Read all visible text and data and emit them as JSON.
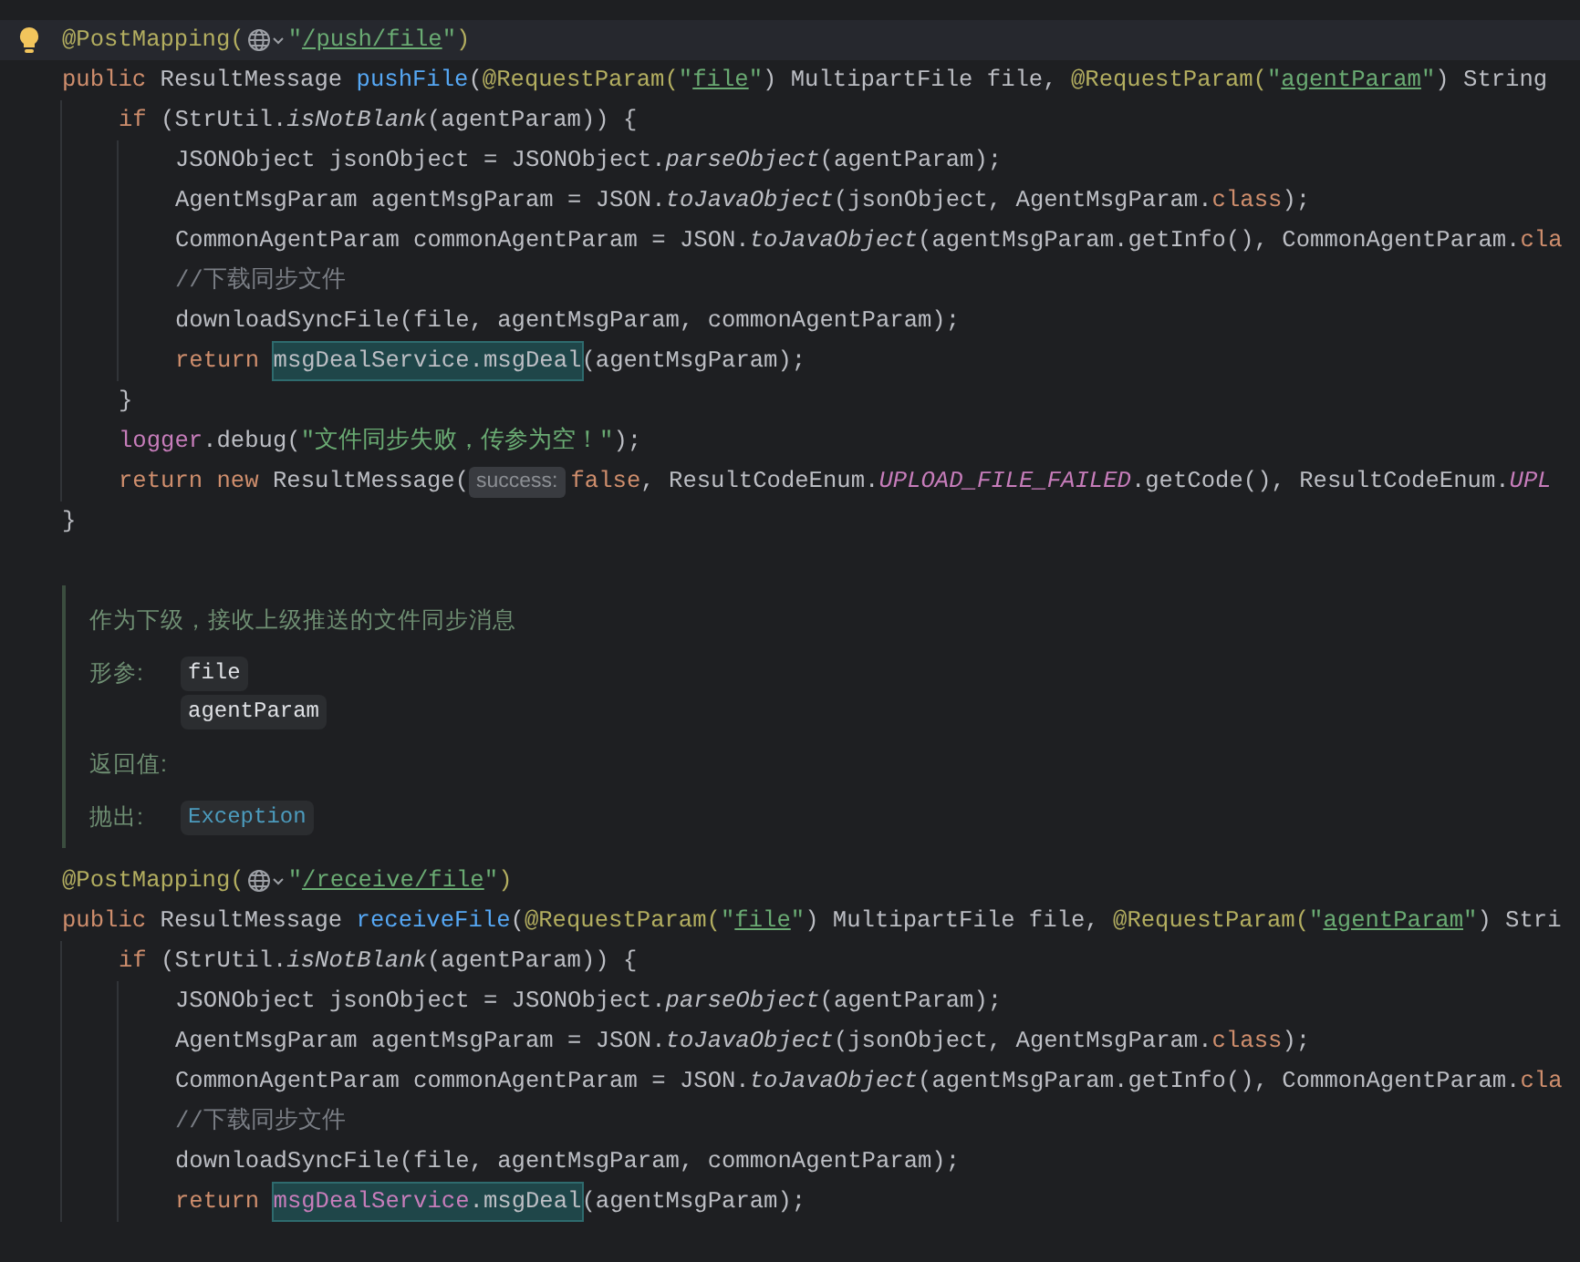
{
  "editor": {
    "blocks": [
      {
        "kind": "code",
        "lines": [
          {
            "current": true,
            "tokens": [
              {
                "text": "@PostMapping(",
                "kind": "annotation"
              },
              {
                "kind": "web"
              },
              {
                "text": "\"",
                "kind": "string"
              },
              {
                "text": "/push/file",
                "kind": "url"
              },
              {
                "text": "\"",
                "kind": "string"
              },
              {
                "text": ")",
                "kind": "annotation"
              }
            ]
          },
          {
            "current": false,
            "tokens": [
              {
                "text": "public ",
                "kind": "keyword"
              },
              {
                "text": "ResultMessage ",
                "kind": "plain"
              },
              {
                "text": "pushFile",
                "kind": "decl"
              },
              {
                "text": "(",
                "kind": "plain"
              },
              {
                "text": "@RequestParam(",
                "kind": "annotation"
              },
              {
                "text": "\"",
                "kind": "string"
              },
              {
                "text": "file",
                "kind": "url"
              },
              {
                "text": "\"",
                "kind": "string"
              },
              {
                "text": ") MultipartFile file, ",
                "kind": "plain"
              },
              {
                "text": "@RequestParam(",
                "kind": "annotation"
              },
              {
                "text": "\"",
                "kind": "string"
              },
              {
                "text": "agentParam",
                "kind": "url"
              },
              {
                "text": "\"",
                "kind": "string"
              },
              {
                "text": ") String",
                "kind": "plain"
              }
            ],
            "children": [
              {
                "current": false,
                "tokens": [
                  {
                    "text": "if ",
                    "kind": "keyword"
                  },
                  {
                    "text": "(StrUtil.",
                    "kind": "plain"
                  },
                  {
                    "text": "isNotBlank",
                    "kind": "static"
                  },
                  {
                    "text": "(agentParam)) {",
                    "kind": "plain"
                  }
                ],
                "children": [
                  {
                    "current": false,
                    "tokens": [
                      {
                        "text": "JSONObject jsonObject = JSONObject.",
                        "kind": "plain"
                      },
                      {
                        "text": "parseObject",
                        "kind": "static"
                      },
                      {
                        "text": "(agentParam);",
                        "kind": "plain"
                      }
                    ]
                  },
                  {
                    "current": false,
                    "tokens": [
                      {
                        "text": "AgentMsgParam agentMsgParam = JSON.",
                        "kind": "plain"
                      },
                      {
                        "text": "toJavaObject",
                        "kind": "static"
                      },
                      {
                        "text": "(jsonObject, AgentMsgParam.",
                        "kind": "plain"
                      },
                      {
                        "text": "class",
                        "kind": "keyword"
                      },
                      {
                        "text": ");",
                        "kind": "plain"
                      }
                    ]
                  },
                  {
                    "current": false,
                    "tokens": [
                      {
                        "text": "CommonAgentParam commonAgentParam = JSON.",
                        "kind": "plain"
                      },
                      {
                        "text": "toJavaObject",
                        "kind": "static"
                      },
                      {
                        "text": "(agentMsgParam.getInfo(), CommonAgentParam.",
                        "kind": "plain"
                      },
                      {
                        "text": "cla",
                        "kind": "keyword"
                      }
                    ]
                  },
                  {
                    "current": false,
                    "tokens": [
                      {
                        "text": "//下载同步文件",
                        "kind": "comment"
                      }
                    ]
                  },
                  {
                    "current": false,
                    "tokens": [
                      {
                        "text": "downloadSyncFile(file, agentMsgParam, commonAgentParam);",
                        "kind": "plain"
                      }
                    ]
                  },
                  {
                    "current": false,
                    "tokens": [
                      {
                        "text": "return ",
                        "kind": "keyword"
                      },
                      {
                        "text": "msgDealService.msgDeal",
                        "kind": "usage"
                      },
                      {
                        "text": "(agentMsgParam);",
                        "kind": "plain"
                      }
                    ]
                  }
                ]
              },
              {
                "current": false,
                "tokens": [
                  {
                    "text": "}",
                    "kind": "plain"
                  }
                ]
              },
              {
                "current": false,
                "tokens": [
                  {
                    "text": "logger",
                    "kind": "field"
                  },
                  {
                    "text": ".debug(",
                    "kind": "plain"
                  },
                  {
                    "text": "\"文件同步失败，传参为空！\"",
                    "kind": "string"
                  },
                  {
                    "text": ");",
                    "kind": "plain"
                  }
                ]
              },
              {
                "current": false,
                "tokens": [
                  {
                    "text": "return new ",
                    "kind": "keyword"
                  },
                  {
                    "text": "ResultMessage(",
                    "kind": "plain"
                  },
                  {
                    "text": "success:",
                    "kind": "hint"
                  },
                  {
                    "text": "false",
                    "kind": "keyword"
                  },
                  {
                    "text": ", ResultCodeEnum.",
                    "kind": "plain"
                  },
                  {
                    "text": "UPLOAD_FILE_FAILED",
                    "kind": "constant"
                  },
                  {
                    "text": ".getCode(), ResultCodeEnum.",
                    "kind": "plain"
                  },
                  {
                    "text": "UPL",
                    "kind": "constant"
                  }
                ]
              }
            ]
          },
          {
            "current": false,
            "tokens": [
              {
                "text": "}",
                "kind": "plain"
              }
            ]
          }
        ]
      },
      {
        "kind": "doc",
        "description": "作为下级，接收上级推送的文件同步消息",
        "sections": [
          {
            "label": "形参:",
            "values": [
              {
                "text": "file",
                "kind": "param"
              },
              {
                "text": "agentParam",
                "kind": "param"
              }
            ]
          },
          {
            "label": "返回值:"
          },
          {
            "label": "抛出:",
            "values": [
              {
                "text": "Exception",
                "kind": "link"
              }
            ]
          }
        ]
      },
      {
        "kind": "code",
        "lines": [
          {
            "current": false,
            "tokens": [
              {
                "text": "@PostMapping(",
                "kind": "annotation"
              },
              {
                "kind": "web"
              },
              {
                "text": "\"",
                "kind": "string"
              },
              {
                "text": "/receive/file",
                "kind": "url"
              },
              {
                "text": "\"",
                "kind": "string"
              },
              {
                "text": ")",
                "kind": "annotation"
              }
            ]
          },
          {
            "current": false,
            "tokens": [
              {
                "text": "public ",
                "kind": "keyword"
              },
              {
                "text": "ResultMessage ",
                "kind": "plain"
              },
              {
                "text": "receiveFile",
                "kind": "decl"
              },
              {
                "text": "(",
                "kind": "plain"
              },
              {
                "text": "@RequestParam(",
                "kind": "annotation"
              },
              {
                "text": "\"",
                "kind": "string"
              },
              {
                "text": "file",
                "kind": "url"
              },
              {
                "text": "\"",
                "kind": "string"
              },
              {
                "text": ") MultipartFile file, ",
                "kind": "plain"
              },
              {
                "text": "@RequestParam(",
                "kind": "annotation"
              },
              {
                "text": "\"",
                "kind": "string"
              },
              {
                "text": "agentParam",
                "kind": "url"
              },
              {
                "text": "\"",
                "kind": "string"
              },
              {
                "text": ") Stri",
                "kind": "plain"
              }
            ],
            "children": [
              {
                "current": false,
                "tokens": [
                  {
                    "text": "if ",
                    "kind": "keyword"
                  },
                  {
                    "text": "(StrUtil.",
                    "kind": "plain"
                  },
                  {
                    "text": "isNotBlank",
                    "kind": "static"
                  },
                  {
                    "text": "(agentParam)) {",
                    "kind": "plain"
                  }
                ],
                "children": [
                  {
                    "current": false,
                    "tokens": [
                      {
                        "text": "JSONObject jsonObject = JSONObject.",
                        "kind": "plain"
                      },
                      {
                        "text": "parseObject",
                        "kind": "static"
                      },
                      {
                        "text": "(agentParam);",
                        "kind": "plain"
                      }
                    ]
                  },
                  {
                    "current": false,
                    "tokens": [
                      {
                        "text": "AgentMsgParam agentMsgParam = JSON.",
                        "kind": "plain"
                      },
                      {
                        "text": "toJavaObject",
                        "kind": "static"
                      },
                      {
                        "text": "(jsonObject, AgentMsgParam.",
                        "kind": "plain"
                      },
                      {
                        "text": "class",
                        "kind": "keyword"
                      },
                      {
                        "text": ");",
                        "kind": "plain"
                      }
                    ]
                  },
                  {
                    "current": false,
                    "tokens": [
                      {
                        "text": "CommonAgentParam commonAgentParam = JSON.",
                        "kind": "plain"
                      },
                      {
                        "text": "toJavaObject",
                        "kind": "static"
                      },
                      {
                        "text": "(agentMsgParam.getInfo(), CommonAgentParam.",
                        "kind": "plain"
                      },
                      {
                        "text": "cla",
                        "kind": "keyword"
                      }
                    ]
                  },
                  {
                    "current": false,
                    "tokens": [
                      {
                        "text": "//下载同步文件",
                        "kind": "comment"
                      }
                    ]
                  },
                  {
                    "current": false,
                    "tokens": [
                      {
                        "text": "downloadSyncFile(file, agentMsgParam, commonAgentParam);",
                        "kind": "plain"
                      }
                    ]
                  },
                  {
                    "current": false,
                    "tokens": [
                      {
                        "text": "return ",
                        "kind": "keyword"
                      },
                      {
                        "text": "msgDealService",
                        "kind": "usage-field"
                      },
                      {
                        "text": ".msgDeal",
                        "kind": "usage"
                      },
                      {
                        "text": "(agentMsgParam);",
                        "kind": "plain"
                      }
                    ]
                  }
                ]
              }
            ]
          }
        ]
      }
    ]
  }
}
